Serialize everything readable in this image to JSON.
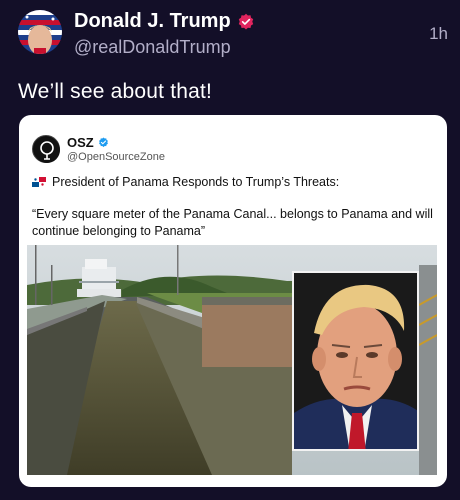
{
  "post": {
    "author_name": "Donald J. Trump",
    "author_handle": "@realDonaldTrump",
    "time": "1h",
    "text": "We’ll see about that!"
  },
  "quoted": {
    "author_name": "OSZ",
    "author_handle": "@OpenSourceZone",
    "headline": "President of Panama Responds to Trump’s Threats:",
    "quote": "“Every square meter of the Panama Canal... belongs to Panama and will continue belonging to Panama”"
  },
  "colors": {
    "background": "#130f28",
    "verified_badge": "#e0245e",
    "quoted_verified_badge": "#1d9bf0"
  },
  "icons": [
    "avatar-flag-icon",
    "verified-badge-icon",
    "osz-logo-icon",
    "panama-flag-icon"
  ]
}
